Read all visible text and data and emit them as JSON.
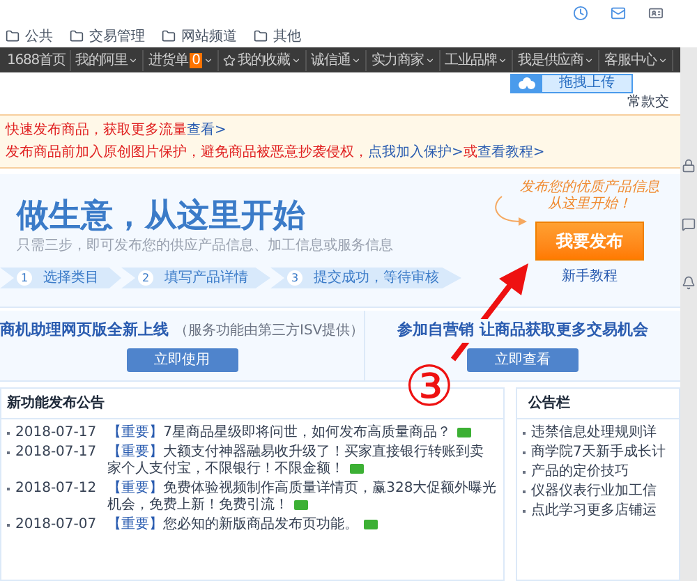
{
  "bookmarks": [
    "公共",
    "交易管理",
    "网站频道",
    "其他"
  ],
  "nav": {
    "items": [
      {
        "label": "1688首页",
        "kind": "link",
        "dropdown": false
      },
      {
        "label": "我的阿里",
        "kind": "link",
        "dropdown": true
      },
      {
        "label": "进货单",
        "kind": "cart",
        "badge": "0",
        "dropdown": true
      },
      {
        "label": "我的收藏",
        "kind": "star",
        "dropdown": true
      },
      {
        "label": "诚信通",
        "kind": "link",
        "dropdown": true
      },
      {
        "label": "实力商家",
        "kind": "link",
        "dropdown": true
      },
      {
        "label": "工业品牌",
        "kind": "link",
        "dropdown": true
      },
      {
        "label": "我是供应商",
        "kind": "link",
        "dropdown": true
      },
      {
        "label": "客服中心",
        "kind": "link",
        "dropdown": true
      }
    ]
  },
  "upload_button": "拖拽上传",
  "header_note": "常款交",
  "notice": {
    "lines": [
      [
        {
          "kind": "plain",
          "text": "快速发布商品，获取更多流量"
        },
        {
          "kind": "link",
          "text": "查看>"
        }
      ],
      [
        {
          "kind": "plain",
          "text": "发布商品前加入原创图片保护，避免商品被恶意抄袭侵权，"
        },
        {
          "kind": "link",
          "text": "点我加入保护>"
        },
        {
          "kind": "plain",
          "text": "或"
        },
        {
          "kind": "link",
          "text": "查看教程>"
        }
      ]
    ]
  },
  "hero": {
    "title": "做生意，从这里开始",
    "subtitle": "只需三步，即可发布您的供应产品信息、加工信息或服务信息",
    "steps": [
      {
        "number": "1",
        "label": "选择类目"
      },
      {
        "number": "2",
        "label": "填写产品详情"
      },
      {
        "number": "3",
        "label": "提交成功，等待审核"
      }
    ],
    "handwritten": [
      "发布您的优质产品信息",
      "从这里开始！"
    ],
    "button": "我要发布",
    "tutorial": "新手教程"
  },
  "promos": [
    {
      "title": "商机助理网页版全新上线",
      "note": "（服务功能由第三方ISV提供）",
      "button": "立即使用"
    },
    {
      "title": "参加自营销 让商品获取更多交易机会",
      "button": "立即查看"
    }
  ],
  "annotation": "③",
  "announcements": {
    "title": "新功能发布公告",
    "items": [
      {
        "date": "2018-07-17",
        "tag": "【重要】",
        "text": "7星商品星级即将问世，如何发布高质量商品？"
      },
      {
        "date": "2018-07-17",
        "tag": "【重要】",
        "text": "大额支付神器融易收升级了！买家直接银行转账到卖家个人支付宝，不限银行！不限金额！"
      },
      {
        "date": "2018-07-12",
        "tag": "【重要】",
        "text": "免费体验视频制作高质量详情页，赢328大促额外曝光机会，免费上新！免费引流！"
      },
      {
        "date": "2018-07-07",
        "tag": "【重要】",
        "text": "您必知的新版商品发布页功能。"
      }
    ]
  },
  "bulletin": {
    "title": "公告栏",
    "items": [
      "违禁信息处理规则详",
      "商学院7天新手成长计",
      "产品的定价技巧",
      "仪器仪表行业加工信",
      "点此学习更多店铺运"
    ]
  }
}
